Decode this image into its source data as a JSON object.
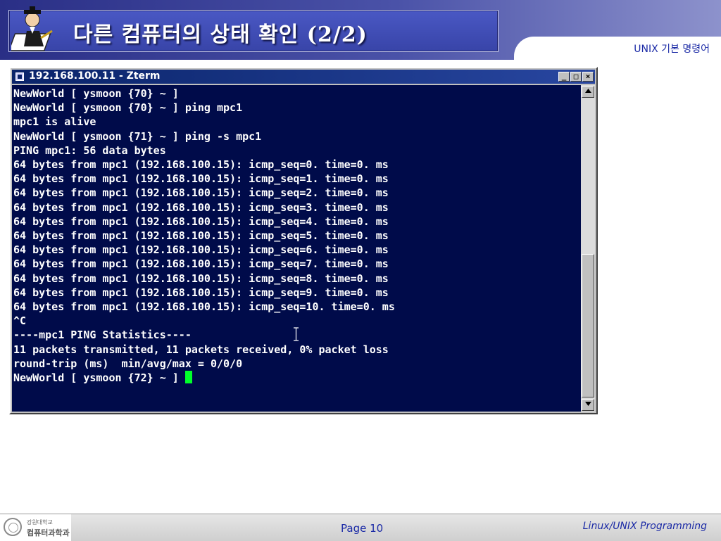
{
  "header": {
    "title": "다른 컴퓨터의 상태 확인 (2/2)",
    "subject": "UNIX 기본 명령어",
    "logo_icon": "professor-writing-icon"
  },
  "window": {
    "title": "192.168.100.11 - Zterm",
    "minimize_label": "_",
    "maximize_label": "□",
    "close_label": "×"
  },
  "terminal": {
    "lines": [
      "NewWorld [ ysmoon {70} ~ ]",
      "NewWorld [ ysmoon {70} ~ ] ping mpc1",
      "mpc1 is alive",
      "NewWorld [ ysmoon {71} ~ ] ping -s mpc1",
      "PING mpc1: 56 data bytes",
      "64 bytes from mpc1 (192.168.100.15): icmp_seq=0. time=0. ms",
      "64 bytes from mpc1 (192.168.100.15): icmp_seq=1. time=0. ms",
      "64 bytes from mpc1 (192.168.100.15): icmp_seq=2. time=0. ms",
      "64 bytes from mpc1 (192.168.100.15): icmp_seq=3. time=0. ms",
      "64 bytes from mpc1 (192.168.100.15): icmp_seq=4. time=0. ms",
      "64 bytes from mpc1 (192.168.100.15): icmp_seq=5. time=0. ms",
      "64 bytes from mpc1 (192.168.100.15): icmp_seq=6. time=0. ms",
      "64 bytes from mpc1 (192.168.100.15): icmp_seq=7. time=0. ms",
      "64 bytes from mpc1 (192.168.100.15): icmp_seq=8. time=0. ms",
      "64 bytes from mpc1 (192.168.100.15): icmp_seq=9. time=0. ms",
      "64 bytes from mpc1 (192.168.100.15): icmp_seq=10. time=0. ms",
      "^C",
      "----mpc1 PING Statistics----",
      "11 packets transmitted, 11 packets received, 0% packet loss",
      "round-trip (ms)  min/avg/max = 0/0/0"
    ],
    "prompt": "NewWorld [ ysmoon {72} ~ ] ",
    "background_color": "#000b4a",
    "cursor_color": "#00ff2a"
  },
  "footer": {
    "university": "강원대학교",
    "department": "컴퓨터과학과",
    "page": "Page 10",
    "course": "Linux/UNIX Programming"
  }
}
